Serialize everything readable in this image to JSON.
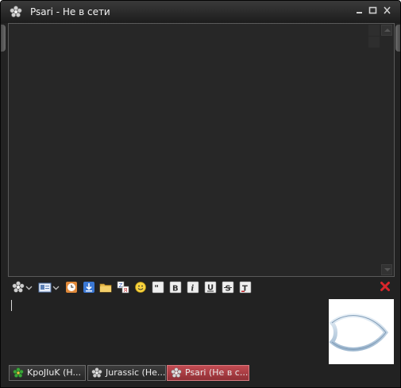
{
  "window": {
    "title": "Psari - Не в сети",
    "controls": [
      "minimize",
      "maximize",
      "close"
    ]
  },
  "toolbar": {
    "items": [
      {
        "name": "status-flower",
        "icon": "flower-icon"
      },
      {
        "name": "contact-card",
        "icon": "contact-card-icon"
      },
      {
        "name": "history",
        "icon": "clock-icon"
      },
      {
        "name": "send-file",
        "icon": "download-icon"
      },
      {
        "name": "folder",
        "icon": "folder-icon"
      },
      {
        "name": "translit",
        "icon": "translit-icon"
      },
      {
        "name": "smiley",
        "icon": "smiley-icon"
      },
      {
        "name": "quote",
        "icon": "quote-icon"
      },
      {
        "name": "bold",
        "icon": "bold-icon",
        "glyph": "B"
      },
      {
        "name": "italic",
        "icon": "italic-icon",
        "glyph": "i"
      },
      {
        "name": "underline",
        "icon": "underline-icon",
        "glyph": "U"
      },
      {
        "name": "strike",
        "icon": "strike-icon",
        "glyph": "S"
      },
      {
        "name": "text-color",
        "icon": "text-color-icon",
        "glyph": "T"
      }
    ],
    "close_icon": "close-icon",
    "close_color": "#d9262b"
  },
  "avatar": {
    "icon": "fish-icon"
  },
  "tabs": [
    {
      "label": "KpoJIuK (H...",
      "icon": "flower-green-icon",
      "active": false
    },
    {
      "label": "Jurassic (He...",
      "icon": "flower-gray-icon",
      "active": false
    },
    {
      "label": "Psari (Не в с...",
      "icon": "flower-gray-icon",
      "active": true
    }
  ],
  "colors": {
    "window_bg": "#222222",
    "active_tab": "#b23f46",
    "flower_green": "#3aa53a"
  }
}
